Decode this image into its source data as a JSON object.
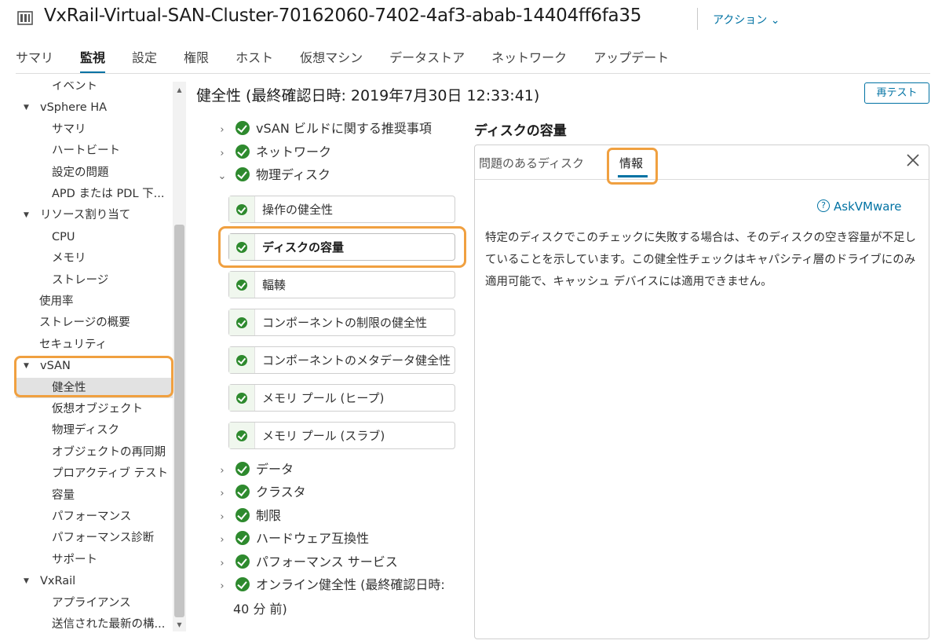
{
  "header": {
    "title": "VxRail-Virtual-SAN-Cluster-70162060-7402-4af3-abab-14404ff6fa35",
    "actions_label": "アクション ⌄"
  },
  "top_tabs": [
    {
      "label": "サマリ",
      "active": false
    },
    {
      "label": "監視",
      "active": true
    },
    {
      "label": "設定",
      "active": false
    },
    {
      "label": "権限",
      "active": false
    },
    {
      "label": "ホスト",
      "active": false
    },
    {
      "label": "仮想マシン",
      "active": false
    },
    {
      "label": "データストア",
      "active": false
    },
    {
      "label": "ネットワーク",
      "active": false
    },
    {
      "label": "アップデート",
      "active": false
    }
  ],
  "nav": {
    "items": [
      {
        "label": "イベント",
        "level": 1
      },
      {
        "label": "vSphere HA",
        "level": 0,
        "caret": true
      },
      {
        "label": "サマリ",
        "level": 1
      },
      {
        "label": "ハートビート",
        "level": 1
      },
      {
        "label": "設定の問題",
        "level": 1
      },
      {
        "label": "APD または PDL 下...",
        "level": 1
      },
      {
        "label": "リソース割り当て",
        "level": 0,
        "caret": true
      },
      {
        "label": "CPU",
        "level": 1
      },
      {
        "label": "メモリ",
        "level": 1
      },
      {
        "label": "ストレージ",
        "level": 1
      },
      {
        "label": "使用率",
        "level": 0
      },
      {
        "label": "ストレージの概要",
        "level": 0
      },
      {
        "label": "セキュリティ",
        "level": 0
      },
      {
        "label": "vSAN",
        "level": 0,
        "caret": true
      },
      {
        "label": "健全性",
        "level": 1,
        "selected": true
      },
      {
        "label": "仮想オブジェクト",
        "level": 1
      },
      {
        "label": "物理ディスク",
        "level": 1
      },
      {
        "label": "オブジェクトの再同期",
        "level": 1
      },
      {
        "label": "プロアクティブ テスト",
        "level": 1
      },
      {
        "label": "容量",
        "level": 1
      },
      {
        "label": "パフォーマンス",
        "level": 1
      },
      {
        "label": "パフォーマンス診断",
        "level": 1
      },
      {
        "label": "サポート",
        "level": 1
      },
      {
        "label": "VxRail",
        "level": 0,
        "caret": true
      },
      {
        "label": "アプライアンス",
        "level": 1
      },
      {
        "label": "送信された最新の構...",
        "level": 1
      }
    ]
  },
  "health": {
    "title": "健全性 (最終確認日時: 2019年7月30日 12:33:41)",
    "retest_label": "再テスト",
    "groups_top": [
      {
        "label": "vSAN ビルドに関する推奨事項",
        "chevron": "›"
      },
      {
        "label": "ネットワーク",
        "chevron": "›"
      },
      {
        "label": "物理ディスク",
        "chevron": "⌄"
      }
    ],
    "children": [
      {
        "label": "操作の健全性",
        "active": false
      },
      {
        "label": "ディスクの容量",
        "active": true
      },
      {
        "label": "輻輳",
        "active": false
      },
      {
        "label": "コンポーネントの制限の健全性",
        "active": false
      },
      {
        "label": "コンポーネントのメタデータ健全性",
        "active": false
      },
      {
        "label": "メモリ プール (ヒープ)",
        "active": false
      },
      {
        "label": "メモリ プール (スラブ)",
        "active": false
      }
    ],
    "groups_bottom": [
      {
        "label": "データ",
        "chevron": "›"
      },
      {
        "label": "クラスタ",
        "chevron": "›"
      },
      {
        "label": "制限",
        "chevron": "›"
      },
      {
        "label": "ハードウェア互換性",
        "chevron": "›"
      },
      {
        "label": "パフォーマンス サービス",
        "chevron": "›"
      },
      {
        "label": "オンライン健全性 (最終確認日時:",
        "chevron": "›"
      }
    ],
    "online_cont": "40 分 前)"
  },
  "detail": {
    "heading": "ディスクの容量",
    "tab_issues": "問題のあるディスク",
    "tab_info": "情報",
    "askvmware": "AskVMware",
    "description": "特定のディスクでこのチェックに失敗する場合は、そのディスクの空き容量が不足していることを示しています。この健全性チェックはキャパシティ層のドライブにのみ適用可能で、キャッシュ デバイスには適用できません。"
  },
  "colors": {
    "accent": "#0072a3",
    "highlight": "#f0a040",
    "ok_green": "#2e8a2e"
  }
}
